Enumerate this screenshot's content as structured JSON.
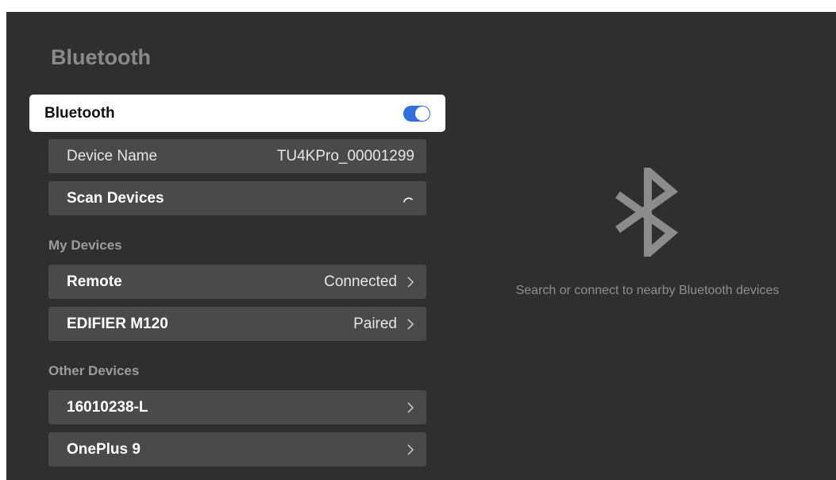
{
  "page": {
    "title": "Bluetooth"
  },
  "bluetooth_toggle": {
    "label": "Bluetooth",
    "enabled": true,
    "accent_color": "#2f6fe0"
  },
  "device_name": {
    "label": "Device Name",
    "value": "TU4KPro_00001299"
  },
  "scan": {
    "label": "Scan Devices",
    "icon": "loading-spinner-icon"
  },
  "my_devices": {
    "header": "My Devices",
    "items": [
      {
        "name": "Remote",
        "status": "Connected"
      },
      {
        "name": "EDIFIER M120",
        "status": "Paired"
      }
    ]
  },
  "other_devices": {
    "header": "Other Devices",
    "items": [
      {
        "name": "16010238-L",
        "status": ""
      },
      {
        "name": "OnePlus 9",
        "status": ""
      }
    ]
  },
  "side_panel": {
    "icon": "bluetooth-icon",
    "hint": "Search or connect to nearby Bluetooth devices"
  }
}
